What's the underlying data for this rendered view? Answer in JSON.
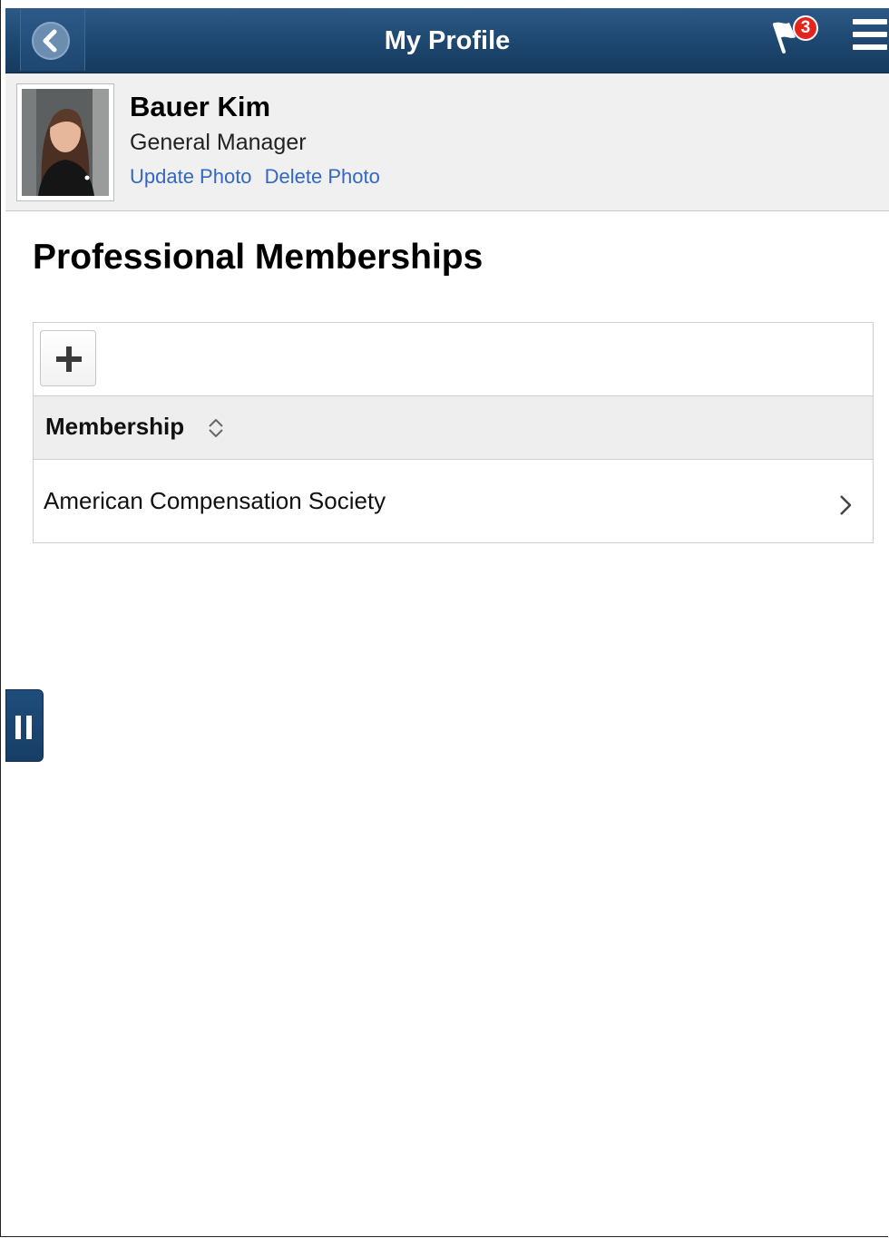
{
  "header": {
    "title": "My Profile",
    "notification_count": "3",
    "back_icon": "chevron-left-icon",
    "flag_icon": "flag-icon",
    "menu_icon": "hamburger-menu-icon",
    "bar_color": "#1f4a73"
  },
  "profile": {
    "name": "Bauer Kim",
    "job_title": "General Manager",
    "update_photo_label": "Update Photo",
    "delete_photo_label": "Delete Photo",
    "link_color": "#3367c2"
  },
  "main": {
    "page_title": "Professional Memberships",
    "add_icon": "plus-icon",
    "grid": {
      "columns": [
        "Membership"
      ],
      "sort_icon": "sort-icon",
      "rows": [
        {
          "membership": "American Compensation Society"
        }
      ],
      "row_icon": "chevron-right-icon"
    }
  },
  "side_handle": {
    "icon": "pause-icon"
  }
}
